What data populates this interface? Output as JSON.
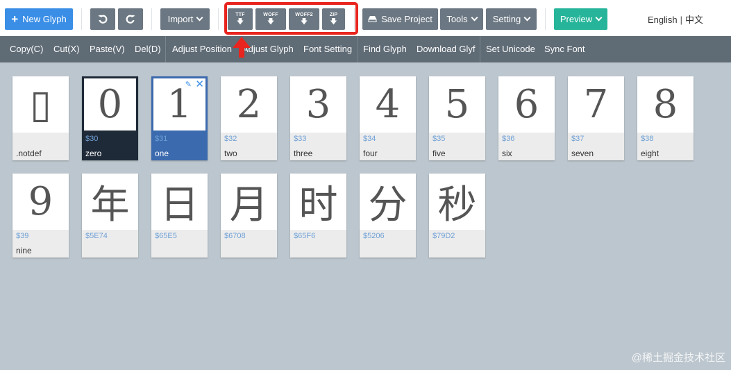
{
  "toolbar": {
    "new_glyph": "New Glyph",
    "undo_icon": "undo-icon",
    "redo_icon": "redo-icon",
    "import": "Import",
    "download_ttf": "TTF",
    "download_woff": "WOFF",
    "download_woff2": "WOFF2",
    "download_zip": "ZIP",
    "save_project": "Save Project",
    "tools": "Tools",
    "setting": "Setting",
    "preview": "Preview",
    "lang_en": "English",
    "lang_divider": "|",
    "lang_zh": "中文",
    "colors": {
      "gray": "#6b7782",
      "blue": "#3a8ee6",
      "teal": "#26b59a",
      "highlight": "#e8251e"
    }
  },
  "menu": {
    "copy": "Copy(C)",
    "cut": "Cut(X)",
    "paste": "Paste(V)",
    "del": "Del(D)",
    "adjust_position": "Adjust Position",
    "adjust_glyph": "Adjust Glyph",
    "font_setting": "Font Setting",
    "find_glyph": "Find Glyph",
    "download_glyf": "Download Glyf",
    "set_unicode": "Set Unicode",
    "sync_font": "Sync Font"
  },
  "glyphs": [
    {
      "char": "▯",
      "code": "",
      "name": ".notdef",
      "state": "normal"
    },
    {
      "char": "0",
      "code": "$30",
      "name": "zero",
      "state": "dark"
    },
    {
      "char": "1",
      "code": "$31",
      "name": "one",
      "state": "selected"
    },
    {
      "char": "2",
      "code": "$32",
      "name": "two",
      "state": "normal"
    },
    {
      "char": "3",
      "code": "$33",
      "name": "three",
      "state": "normal"
    },
    {
      "char": "4",
      "code": "$34",
      "name": "four",
      "state": "normal"
    },
    {
      "char": "5",
      "code": "$35",
      "name": "five",
      "state": "normal"
    },
    {
      "char": "6",
      "code": "$36",
      "name": "six",
      "state": "normal"
    },
    {
      "char": "7",
      "code": "$37",
      "name": "seven",
      "state": "normal"
    },
    {
      "char": "8",
      "code": "$38",
      "name": "eight",
      "state": "normal"
    },
    {
      "char": "9",
      "code": "$39",
      "name": "nine",
      "state": "normal"
    },
    {
      "char": "年",
      "code": "$5E74",
      "name": "",
      "state": "normal"
    },
    {
      "char": "日",
      "code": "$65E5",
      "name": "",
      "state": "normal"
    },
    {
      "char": "月",
      "code": "$6708",
      "name": "",
      "state": "normal"
    },
    {
      "char": "时",
      "code": "$65F6",
      "name": "",
      "state": "normal"
    },
    {
      "char": "分",
      "code": "$5206",
      "name": "",
      "state": "normal"
    },
    {
      "char": "秒",
      "code": "$79D2",
      "name": "",
      "state": "normal"
    }
  ],
  "watermark": "@稀土掘金技术社区"
}
